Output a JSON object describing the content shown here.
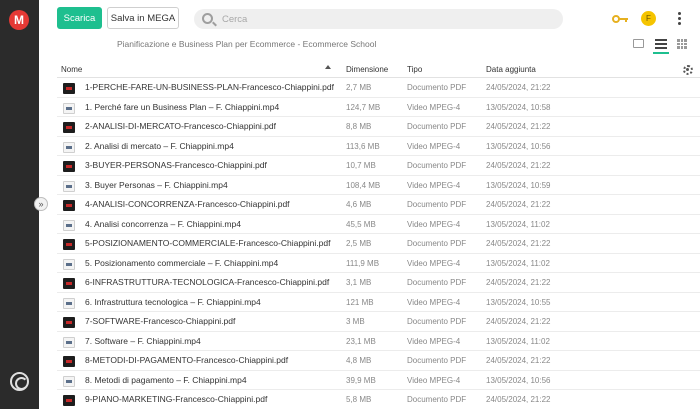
{
  "toolbar": {
    "download_label": "Scarica",
    "save_label": "Salva in MEGA",
    "search_placeholder": "Cerca"
  },
  "sidebar": {
    "logo_letter": "M",
    "expand_glyph": "»"
  },
  "user": {
    "avatar_letter": "F"
  },
  "breadcrumb": "Pianificazione e Business Plan per Ecommerce - Ecommerce School",
  "colors": {
    "accent": "#1ebf8f",
    "logo": "#e53935",
    "avatar": "#f5c400",
    "key": "#e6b020"
  },
  "icons": [
    "mega-logo-icon",
    "search-icon",
    "key-icon",
    "more-vertical-icon",
    "thumbnail-view-icon",
    "list-view-icon",
    "grid-view-icon",
    "settings-icon",
    "sync-icon",
    "pdf-file-icon",
    "video-file-icon"
  ],
  "table": {
    "columns": {
      "name": "Nome",
      "size": "Dimensione",
      "type": "Tipo",
      "date": "Data aggiunta"
    },
    "rows": [
      {
        "name": "1-PERCHE-FARE-UN-BUSINESS-PLAN-Francesco-Chiappini.pdf",
        "size": "2,7 MB",
        "type": "Documento PDF",
        "date": "24/05/2024, 21:22",
        "kind": "pdf"
      },
      {
        "name": "1. Perché fare un Business Plan – F. Chiappini.mp4",
        "size": "124,7 MB",
        "type": "Video MPEG-4",
        "date": "13/05/2024, 10:58",
        "kind": "video"
      },
      {
        "name": "2-ANALISI-DI-MERCATO-Francesco-Chiappini.pdf",
        "size": "8,8 MB",
        "type": "Documento PDF",
        "date": "24/05/2024, 21:22",
        "kind": "pdf"
      },
      {
        "name": "2. Analisi di mercato – F. Chiappini.mp4",
        "size": "113,6 MB",
        "type": "Video MPEG-4",
        "date": "13/05/2024, 10:56",
        "kind": "video"
      },
      {
        "name": "3-BUYER-PERSONAS-Francesco-Chiappini.pdf",
        "size": "10,7 MB",
        "type": "Documento PDF",
        "date": "24/05/2024, 21:22",
        "kind": "pdf"
      },
      {
        "name": "3. Buyer Personas – F. Chiappini.mp4",
        "size": "108,4 MB",
        "type": "Video MPEG-4",
        "date": "13/05/2024, 10:59",
        "kind": "video"
      },
      {
        "name": "4-ANALISI-CONCORRENZA-Francesco-Chiappini.pdf",
        "size": "4,6 MB",
        "type": "Documento PDF",
        "date": "24/05/2024, 21:22",
        "kind": "pdf"
      },
      {
        "name": "4. Analisi concorrenza – F. Chiappini.mp4",
        "size": "45,5 MB",
        "type": "Video MPEG-4",
        "date": "13/05/2024, 11:02",
        "kind": "video"
      },
      {
        "name": "5-POSIZIONAMENTO-COMMERCIALE-Francesco-Chiappini.pdf",
        "size": "2,5 MB",
        "type": "Documento PDF",
        "date": "24/05/2024, 21:22",
        "kind": "pdf"
      },
      {
        "name": "5. Posizionamento commerciale – F. Chiappini.mp4",
        "size": "111,9 MB",
        "type": "Video MPEG-4",
        "date": "13/05/2024, 11:02",
        "kind": "video"
      },
      {
        "name": "6-INFRASTRUTTURA-TECNOLOGICA-Francesco-Chiappini.pdf",
        "size": "3,1 MB",
        "type": "Documento PDF",
        "date": "24/05/2024, 21:22",
        "kind": "pdf"
      },
      {
        "name": "6. Infrastruttura tecnologica – F. Chiappini.mp4",
        "size": "121 MB",
        "type": "Video MPEG-4",
        "date": "13/05/2024, 10:55",
        "kind": "video"
      },
      {
        "name": "7-SOFTWARE-Francesco-Chiappini.pdf",
        "size": "3 MB",
        "type": "Documento PDF",
        "date": "24/05/2024, 21:22",
        "kind": "pdf"
      },
      {
        "name": "7. Software – F. Chiappini.mp4",
        "size": "23,1 MB",
        "type": "Video MPEG-4",
        "date": "13/05/2024, 11:02",
        "kind": "video"
      },
      {
        "name": "8-METODI-DI-PAGAMENTO-Francesco-Chiappini.pdf",
        "size": "4,8 MB",
        "type": "Documento PDF",
        "date": "24/05/2024, 21:22",
        "kind": "pdf"
      },
      {
        "name": "8. Metodi di pagamento – F. Chiappini.mp4",
        "size": "39,9 MB",
        "type": "Video MPEG-4",
        "date": "13/05/2024, 10:56",
        "kind": "video"
      },
      {
        "name": "9-PIANO-MARKETING-Francesco-Chiappini.pdf",
        "size": "5,8 MB",
        "type": "Documento PDF",
        "date": "24/05/2024, 21:22",
        "kind": "pdf"
      }
    ]
  }
}
